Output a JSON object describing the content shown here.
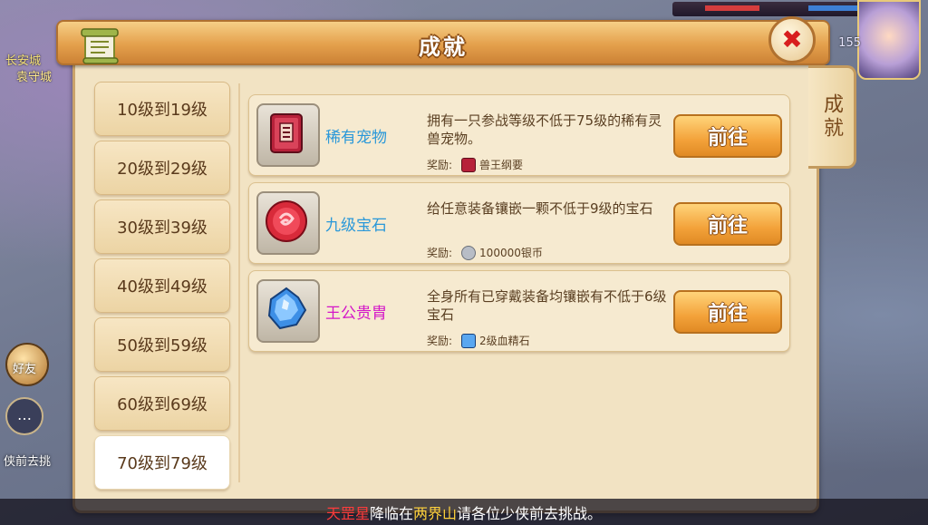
{
  "panel": {
    "title": "成就",
    "side_tab": "成就",
    "close_icon": "close-icon"
  },
  "background": {
    "left_text_1": "长安城",
    "left_text_2": "袁守城",
    "friend_label": "好友",
    "task_text": "侠前去挑",
    "level_number": "155"
  },
  "levels": [
    {
      "label": "10级到19级"
    },
    {
      "label": "20级到29级"
    },
    {
      "label": "30级到39级"
    },
    {
      "label": "40级到49级"
    },
    {
      "label": "50级到59级"
    },
    {
      "label": "60级到69级"
    },
    {
      "label": "70级到79级",
      "active": true
    }
  ],
  "achievements": [
    {
      "name": "稀有宠物",
      "name_color": "#2a98d9",
      "description": "拥有一只参战等级不低于75级的稀有灵兽宠物。",
      "reward_label": "奖励:",
      "reward_value": "兽王纲要",
      "icon": "book-icon",
      "button": "前往"
    },
    {
      "name": "九级宝石",
      "name_color": "#2a98d9",
      "description": "给任意装备镶嵌一颗不低于9级的宝石",
      "reward_label": "奖励:",
      "reward_value": "100000银币",
      "icon": "red-gem-icon",
      "button": "前往"
    },
    {
      "name": "王公贵胄",
      "name_color": "#d417c8",
      "description": "全身所有已穿戴装备均镶嵌有不低于6级宝石",
      "reward_label": "奖励:",
      "reward_value": "2级血精石",
      "icon": "blue-crystal-icon",
      "button": "前往"
    }
  ],
  "ticker": {
    "part1": "天罡星",
    "part2": "降临在",
    "part3": "两界山",
    "part4": "请各位少侠前去挑战。",
    "color_highlight_1": "#ff3b3b",
    "color_highlight_2": "#ffd23c"
  }
}
